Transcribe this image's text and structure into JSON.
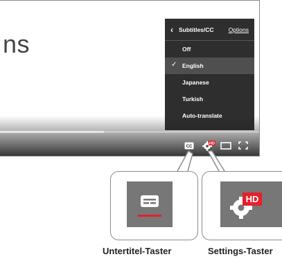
{
  "video": {
    "visible_text": "ns",
    "progress": 0.4
  },
  "menu": {
    "title": "Subtitles/CC",
    "options_label": "Options",
    "items": [
      {
        "label": "Off",
        "selected": false
      },
      {
        "label": "English",
        "selected": true
      },
      {
        "label": "Japanese",
        "selected": false
      },
      {
        "label": "Turkish",
        "selected": false
      },
      {
        "label": "Auto-translate",
        "selected": false
      }
    ]
  },
  "controls": {
    "subtitles_badge": "CC",
    "hd_badge": "HD"
  },
  "callouts": {
    "subtitles_label": "Untertitel-Taster",
    "settings_label": "Settings-Taster",
    "hd_badge": "HD"
  },
  "colors": {
    "accent_red": "#e5202a",
    "menu_bg": "#1c1c1c",
    "tile_bg": "#777777"
  }
}
